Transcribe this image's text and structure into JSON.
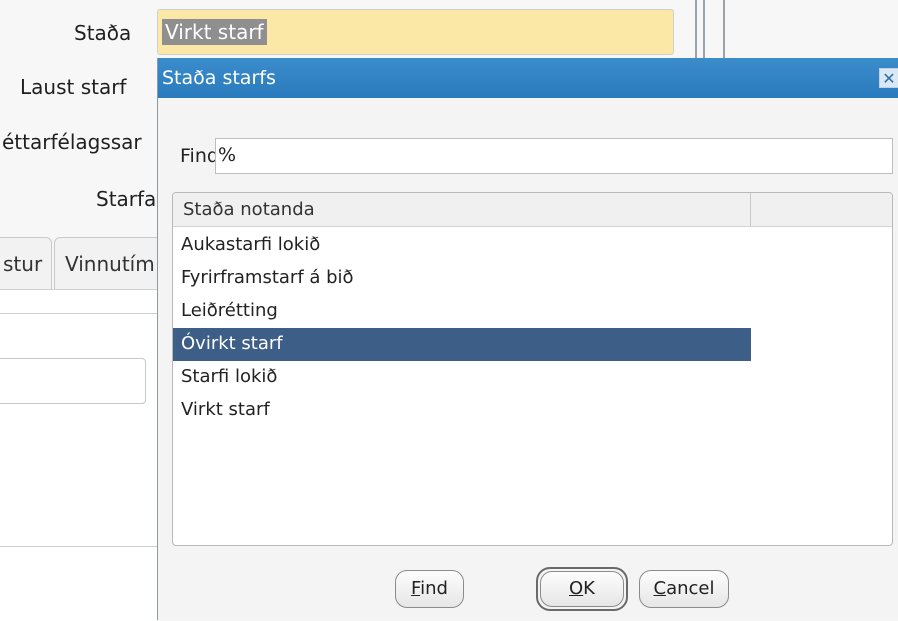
{
  "background_form": {
    "labels": {
      "stada": "Staða",
      "laust_starf": "Laust starf",
      "stettarfelag": "éttarfélagssar",
      "starfa": "Starfa"
    },
    "stada_value": "Virkt starf",
    "tabs": [
      "stur",
      "Vinnutím"
    ]
  },
  "dialog": {
    "title": "Staða starfs",
    "close_glyph": "✕",
    "find_label": "Find",
    "find_value": "%",
    "list": {
      "column_header": "Staða notanda",
      "rows": [
        "Aukastarfi lokið",
        "Fyrirframstarf á bið",
        "Leiðrétting",
        "Óvirkt starf",
        "Starfi lokið",
        "Virkt starf"
      ],
      "selected_index": 3
    },
    "buttons": {
      "find": {
        "mnemonic": "F",
        "rest": "ind"
      },
      "ok": {
        "mnemonic": "O",
        "rest": "K"
      },
      "cancel": {
        "mnemonic": "C",
        "rest": "ancel"
      }
    }
  }
}
